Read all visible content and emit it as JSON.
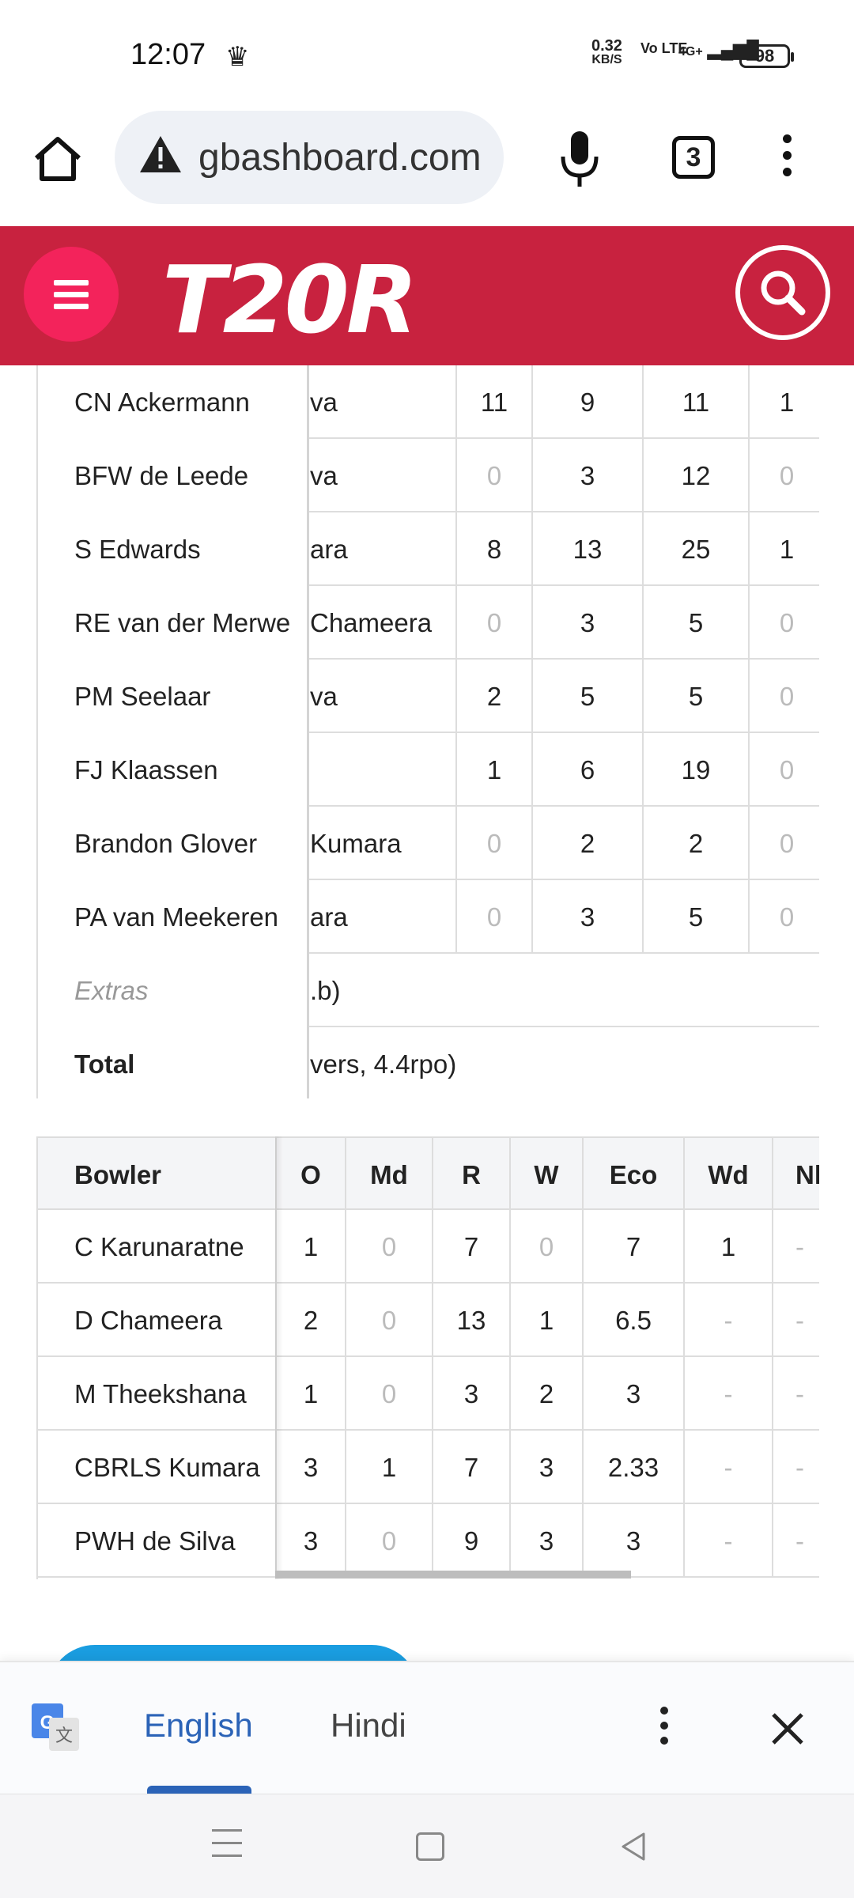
{
  "status_bar": {
    "time": "12:07",
    "net_speed": "0.32",
    "net_unit": "KB/S",
    "volte": "Vo LTE",
    "signal": "4G+",
    "battery": "98"
  },
  "browser": {
    "url": "gbashboard.com",
    "tab_count": "3"
  },
  "site": {
    "logo": "T20R"
  },
  "batting": {
    "rows": [
      {
        "name": "CN Ackermann",
        "dismissal": "va",
        "c1": "11",
        "c2": "9",
        "c3": "11",
        "c4": "1",
        "m1": false,
        "m4": false
      },
      {
        "name": "BFW de Leede",
        "dismissal": "va",
        "c1": "0",
        "c2": "3",
        "c3": "12",
        "c4": "0",
        "m1": true,
        "m4": true
      },
      {
        "name": "S Edwards",
        "dismissal": "ara",
        "c1": "8",
        "c2": "13",
        "c3": "25",
        "c4": "1",
        "m1": false,
        "m4": false
      },
      {
        "name": "RE van der Merwe",
        "dismissal": "Chameera",
        "c1": "0",
        "c2": "3",
        "c3": "5",
        "c4": "0",
        "m1": true,
        "m4": true
      },
      {
        "name": "PM Seelaar",
        "dismissal": "va",
        "c1": "2",
        "c2": "5",
        "c3": "5",
        "c4": "0",
        "m1": false,
        "m4": true
      },
      {
        "name": "FJ Klaassen",
        "dismissal": "",
        "c1": "1",
        "c2": "6",
        "c3": "19",
        "c4": "0",
        "m1": false,
        "m4": true
      },
      {
        "name": "Brandon Glover",
        "dismissal": "Kumara",
        "c1": "0",
        "c2": "2",
        "c3": "2",
        "c4": "0",
        "m1": true,
        "m4": true
      },
      {
        "name": "PA van Meekeren",
        "dismissal": "ara",
        "c1": "0",
        "c2": "3",
        "c3": "5",
        "c4": "0",
        "m1": true,
        "m4": true
      }
    ],
    "extras_label": "Extras",
    "extras_value": ".b)",
    "total_label": "Total",
    "total_value": "vers, 4.4rpo)"
  },
  "bowling": {
    "headers": [
      "Bowler",
      "O",
      "Md",
      "R",
      "W",
      "Eco",
      "Wd",
      "Nb"
    ],
    "header_nb_visible": "Nl",
    "rows": [
      {
        "name": "C Karunaratne",
        "o": "1",
        "md": "0",
        "r": "7",
        "w": "0",
        "eco": "7",
        "wd": "1",
        "nb": "-"
      },
      {
        "name": "D Chameera",
        "o": "2",
        "md": "0",
        "r": "13",
        "w": "1",
        "eco": "6.5",
        "wd": "-",
        "nb": "-"
      },
      {
        "name": "M Theekshana",
        "o": "1",
        "md": "0",
        "r": "3",
        "w": "2",
        "eco": "3",
        "wd": "-",
        "nb": "-"
      },
      {
        "name": "CBRLS Kumara",
        "o": "3",
        "md": "1",
        "r": "7",
        "w": "3",
        "eco": "2.33",
        "wd": "-",
        "nb": "-"
      },
      {
        "name": "PWH de Silva",
        "o": "3",
        "md": "0",
        "r": "9",
        "w": "3",
        "eco": "3",
        "wd": "-",
        "nb": "-"
      }
    ]
  },
  "translate": {
    "lang_selected": "English",
    "lang_other": "Hindi"
  },
  "colors": {
    "brand_red": "#c8223f",
    "menu_pink": "#f3235b",
    "translate_blue": "#2b63b7"
  }
}
